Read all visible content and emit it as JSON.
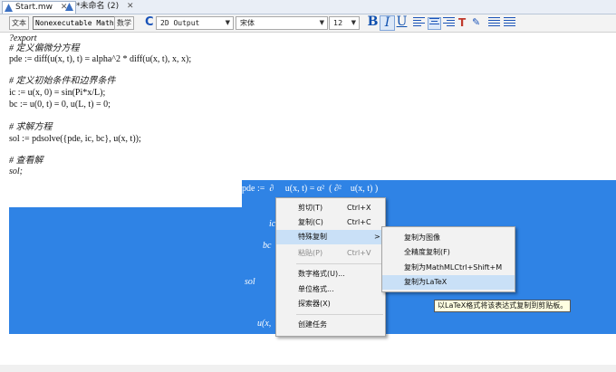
{
  "tabs": [
    {
      "label": "Start.mw",
      "close": "✕"
    },
    {
      "label": "*未命名 (2)",
      "close": "✕"
    }
  ],
  "toolbar": {
    "text_btn": "文本",
    "math_btn": "Nonexecutable Math",
    "num_btn": "数学",
    "output_mode": "2D Output",
    "font": "宋体",
    "size": "12",
    "bold": "B",
    "italic": "I",
    "underline": "U"
  },
  "code_lines": [
    "?export",
    "# 定义偏微分方程",
    "pde := diff(u(x, t), t) = alpha^2 * diff(u(x, t), x, x);",
    "",
    "# 定义初始条件和边界条件",
    "ic := u(x, 0) = sin(Pi*x/L);",
    "bc := u(0, t) = 0, u(L, t) = 0;",
    "",
    "# 求解方程",
    "sol := pdsolve({pde, ic, bc}, u(x, t));",
    "",
    "# 查看解",
    "sol;"
  ],
  "output": {
    "pde_line": "pde :=  ∂     u(x, t) = α²  ( ∂²    u(x, t) )",
    "ic_frag": "ic",
    "bc_frag": "bc",
    "sol_frag": "sol",
    "u_frag": "u(x,"
  },
  "context_menu": {
    "items": [
      {
        "label": "剪切(T)",
        "shortcut": "Ctrl+X"
      },
      {
        "label": "复制(C)",
        "shortcut": "Ctrl+C"
      },
      {
        "label": "特殊复制",
        "shortcut": ">"
      },
      {
        "label": "粘贴(P)",
        "shortcut": "Ctrl+V"
      },
      {
        "label": "数字格式(U)..."
      },
      {
        "label": "单位格式..."
      },
      {
        "label": "探索器(X)"
      },
      {
        "label": "创建任务"
      }
    ]
  },
  "submenu": {
    "items": [
      {
        "label": "复制为图像"
      },
      {
        "label": "全精度复制(F)"
      },
      {
        "label": "复制为MathMLCtrl+Shift+M"
      },
      {
        "label": "复制为LaTeX"
      }
    ]
  },
  "tooltip": "以LaTeX格式将该表达式复制到剪贴板。",
  "colors": {
    "selection": "#2f83e5",
    "menu_highlight": "#c9e0f7"
  }
}
